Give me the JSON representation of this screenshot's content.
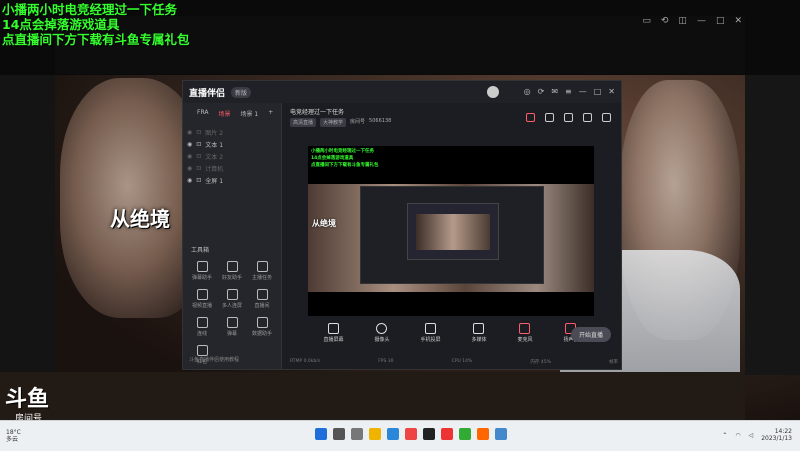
{
  "overlay": {
    "line1": "小播两小时电竞经理过一下任务",
    "line2": "14点会掉落游戏道具",
    "line3": "点直播间下方下载有斗鱼专属礼包"
  },
  "douyu": {
    "logo": "斗鱼",
    "sub": "房间号",
    "room_number": "5066138"
  },
  "big_caption": "从绝境",
  "app": {
    "logo": "直播伴侣",
    "version": "新版",
    "tabs": [
      "FRA",
      "场景",
      "场景 1",
      "+"
    ],
    "scenes": [
      {
        "label": "图片 2",
        "dim": true
      },
      {
        "label": "文本 1",
        "dim": false
      },
      {
        "label": "文本 2",
        "dim": true
      },
      {
        "label": "计算机",
        "dim": true
      },
      {
        "label": "全屏 1",
        "dim": false
      }
    ],
    "tools_head": "工具箱",
    "tools": [
      "弹幕助手",
      "好友助手",
      "主播任务",
      "视频直播",
      "多人连屏",
      "直播间",
      "连线",
      "弹幕",
      "数据助手",
      "红包",
      "",
      ""
    ],
    "left_footer": "斗鱼直播伴侣使用教程",
    "room_title": "电竞经理过一下任务",
    "room_category": "推荐",
    "room_edit": "房间标题",
    "tags": [
      "高清直播",
      "大神教学",
      "房间号",
      "5066138"
    ],
    "bottom_buttons": [
      "直播屏幕",
      "摄像头",
      "手机投屏",
      "多媒体",
      "麦克风",
      "扬声器"
    ],
    "start_label": "开始直播",
    "status": [
      "",
      "RTMP 0.0kb/s",
      "FPS 30",
      "CPU 14%",
      "内存 45%",
      "帧率"
    ],
    "preview_lines": [
      "小播两小时电竞经理过一下任务",
      "14点会掉落游戏道具",
      "点直播间下方下载有斗鱼专属礼包"
    ],
    "preview_caption": "从绝境"
  },
  "watermark": "",
  "taskbar": {
    "weather": "18°C",
    "weather_sub": "多云",
    "time": "14:22",
    "date": "2023/1/13"
  }
}
